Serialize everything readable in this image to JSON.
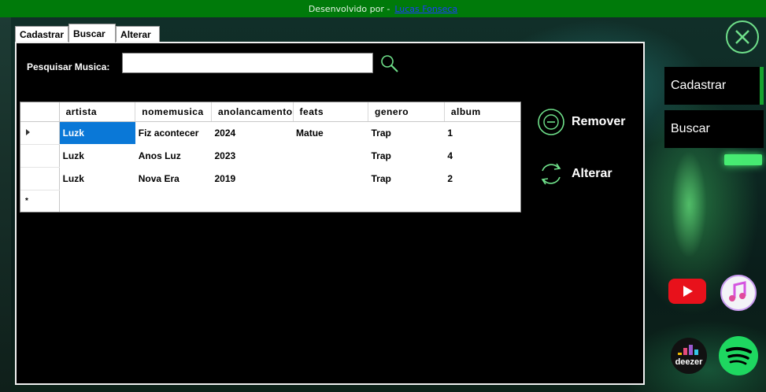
{
  "topbar": {
    "text": "Desenvolvido por -",
    "link": "Lucas Fonseca"
  },
  "tabs": [
    {
      "label": "Cadastrar",
      "active": false
    },
    {
      "label": "Buscar",
      "active": true
    },
    {
      "label": "Alterar",
      "active": false
    }
  ],
  "search": {
    "label": "Pesquisar Musica:",
    "value": "",
    "icon": "search-icon"
  },
  "grid": {
    "columns": [
      "artista",
      "nomemusica",
      "anolancamento",
      "feats",
      "genero",
      "album"
    ],
    "rows": [
      {
        "artista": "Luzk",
        "nomemusica": "Fiz acontecer",
        "anolancamento": "2024",
        "feats": "Matue",
        "genero": "Trap",
        "album": "1",
        "current": true
      },
      {
        "artista": "Luzk",
        "nomemusica": "Anos Luz",
        "anolancamento": "2023",
        "feats": "",
        "genero": "Trap",
        "album": "4"
      },
      {
        "artista": "Luzk",
        "nomemusica": "Nova Era",
        "anolancamento": "2019",
        "feats": "",
        "genero": "Trap",
        "album": "2"
      }
    ],
    "new_row_marker": "*",
    "selected_color": "#0a78d7"
  },
  "actions": {
    "remove_label": "Remover",
    "alterar_label": "Alterar",
    "icon_color": "#6fe08a"
  },
  "sidebar": {
    "cadastrar_label": "Cadastrar",
    "buscar_label": "Buscar",
    "accent": "#16a32e"
  },
  "apps": [
    "youtube-icon",
    "itunes-icon",
    "deezer-icon",
    "spotify-icon"
  ],
  "app_labels": {
    "deezer": "deezer"
  },
  "colors": {
    "topbar": "#007a0a",
    "close": "#6fe08a",
    "link": "#1e3cff"
  }
}
